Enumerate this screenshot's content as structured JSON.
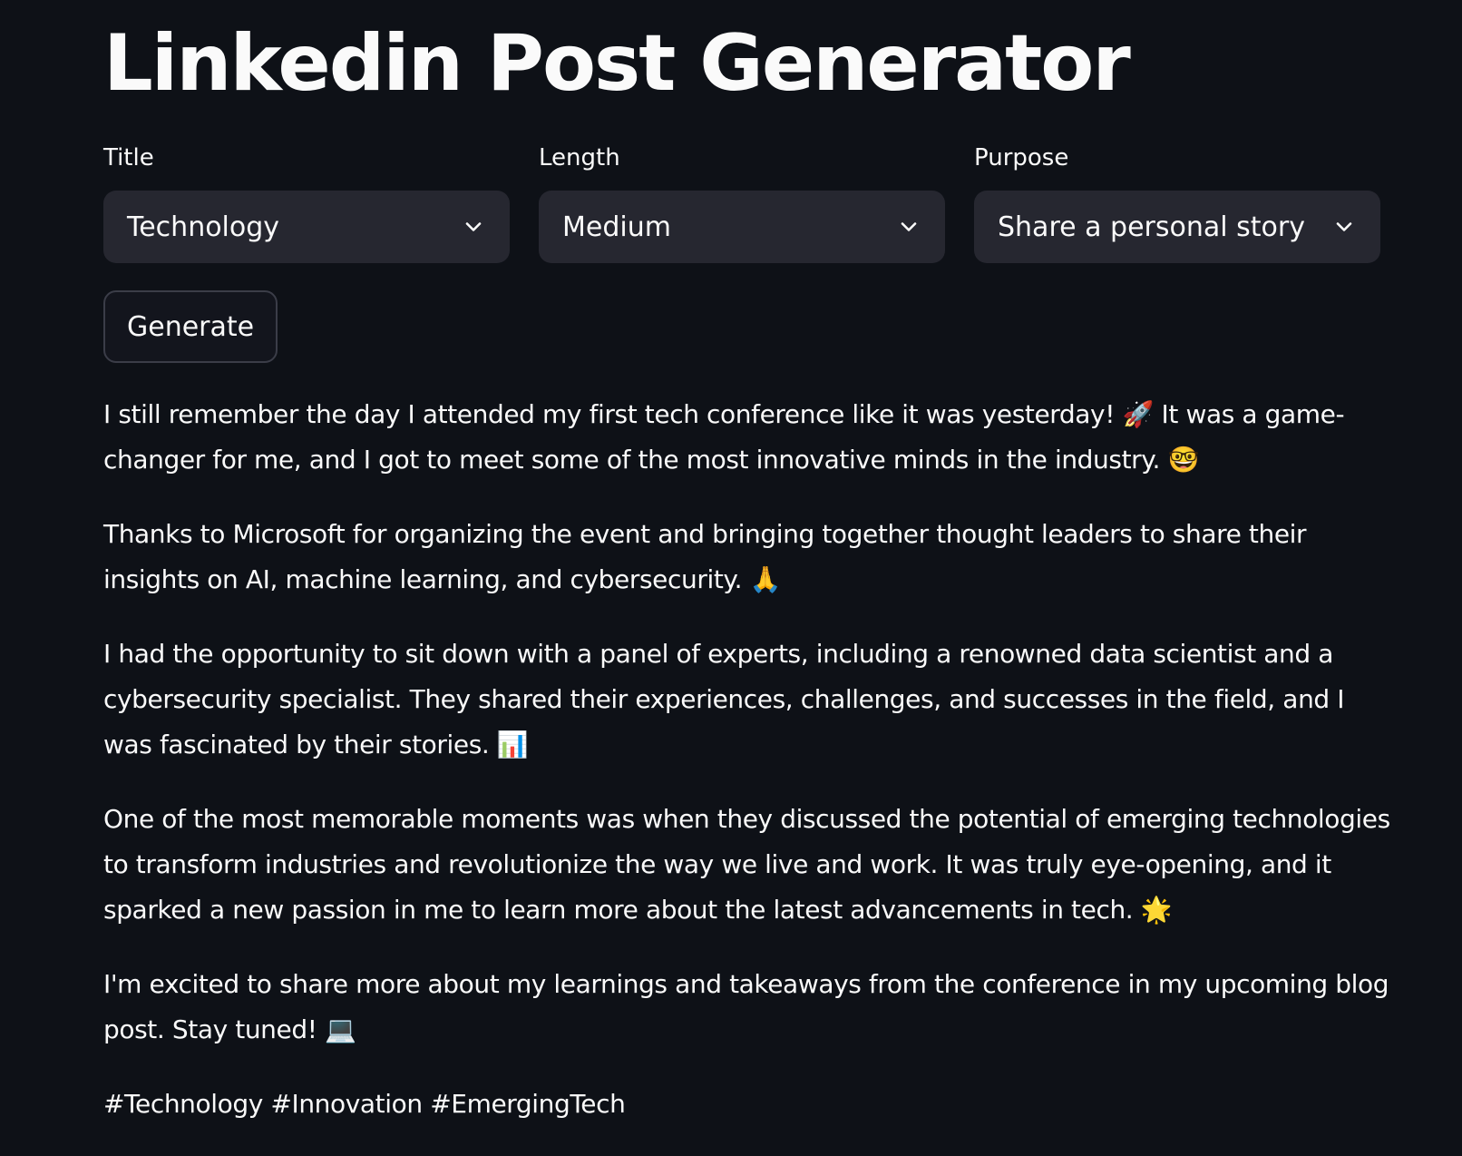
{
  "app": {
    "title": "Linkedin Post Generator"
  },
  "controls": {
    "title": {
      "label": "Title",
      "value": "Technology"
    },
    "length": {
      "label": "Length",
      "value": "Medium"
    },
    "purpose": {
      "label": "Purpose",
      "value": "Share a personal story"
    }
  },
  "actions": {
    "generate_label": "Generate"
  },
  "post": {
    "paragraphs": [
      "I still remember the day I attended my first tech conference like it was yesterday! 🚀 It was a game-changer for me, and I got to meet some of the most innovative minds in the industry. 🤓",
      "Thanks to Microsoft for organizing the event and bringing together thought leaders to share their insights on AI, machine learning, and cybersecurity. 🙏",
      "I had the opportunity to sit down with a panel of experts, including a renowned data scientist and a cybersecurity specialist. They shared their experiences, challenges, and successes in the field, and I was fascinated by their stories. 📊",
      "One of the most memorable moments was when they discussed the potential of emerging technologies to transform industries and revolutionize the way we live and work. It was truly eye-opening, and it sparked a new passion in me to learn more about the latest advancements in tech. 🌟",
      "I'm excited to share more about my learnings and takeaways from the conference in my upcoming blog post. Stay tuned! 💻",
      "#Technology #Innovation #EmergingTech"
    ]
  },
  "icons": {
    "dropdown": "chevron-down-icon"
  },
  "colors": {
    "background": "#0e1117",
    "select_background": "#262730",
    "button_background": "#13151d",
    "button_border": "#3b3d48",
    "text": "#fafafa"
  }
}
